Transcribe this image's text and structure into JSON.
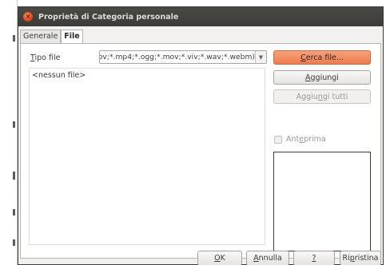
{
  "window": {
    "title": "Proprietà di Categoria personale"
  },
  "tabs": [
    {
      "label": "Generale",
      "active": false
    },
    {
      "label": "File",
      "active": true
    }
  ],
  "file_type": {
    "label_mnemonic": "T",
    "label_rest": "ipo file",
    "value": "ov;*.mp4;*.ogg;*.mov;*.viv;*.wav;*.webm)"
  },
  "file_list": {
    "empty_text": "<nessun file>"
  },
  "buttons": {
    "find_mnemonic": "C",
    "find_rest": "erca file...",
    "add_mnemonic": "A",
    "add_rest": "ggiungi",
    "add_all_pre": "Aggiu",
    "add_all_mnemonic": "n",
    "add_all_post": "gi tutti"
  },
  "preview": {
    "label_pre": "Ant",
    "label_mnemonic": "e",
    "label_post": "prima",
    "checked": false
  },
  "footer": {
    "ok_mnemonic": "O",
    "ok_rest": "K",
    "cancel_mnemonic": "A",
    "cancel_rest": "nnulla",
    "help_label": "?",
    "reset_pre": "Ri",
    "reset_mnemonic": "p",
    "reset_post": "ristina"
  },
  "colors": {
    "accent": "#ee7b4e",
    "titlebar": "#3c3b37"
  }
}
